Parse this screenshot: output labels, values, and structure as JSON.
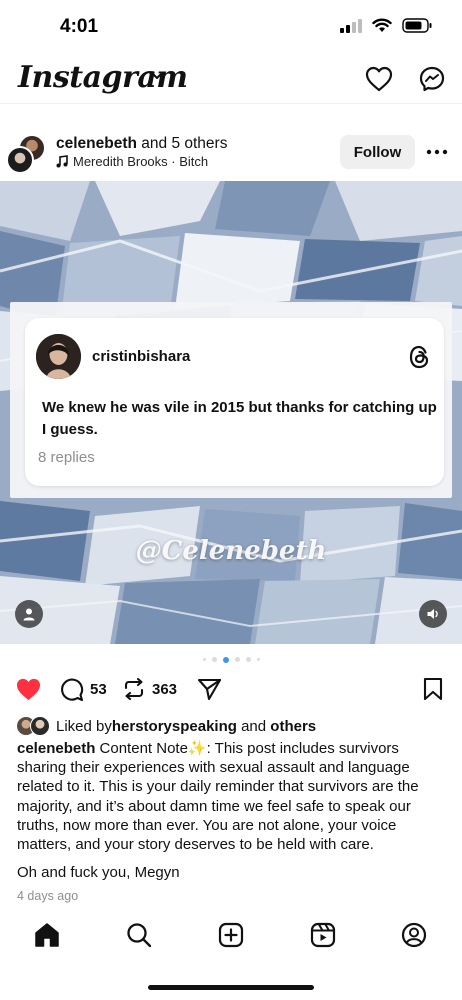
{
  "status_bar": {
    "time": "4:01"
  },
  "header": {
    "brand": "Instagram"
  },
  "post": {
    "author": "celenebeth",
    "author_suffix": " and 5 others",
    "music": "Meredith Brooks · Bitch",
    "follow_label": "Follow"
  },
  "card": {
    "username": "cristinbishara",
    "text": "We knew he was vile in 2015 but thanks for catching up I guess.",
    "replies": "8 replies"
  },
  "watermark": "@Celenebeth",
  "carousel": {
    "count": 6,
    "active_index": 2
  },
  "actions": {
    "comments": "53",
    "reposts": "363",
    "liked": true
  },
  "likes": {
    "prefix": "Liked by ",
    "user": "herstoryspeaking",
    "mid": " and ",
    "others": "others"
  },
  "caption": {
    "author": "celenebeth",
    "text": " Content Note✨: This post includes survivors sharing their experiences with sexual assault and language related to it. This is your daily reminder that survivors are the majority, and it’s about damn time we feel safe to speak our truths, now more than ever. You are not alone, your voice matters, and your story deserves to be held with care.",
    "text2": "Oh and fuck you, Megyn"
  },
  "time_ago": "4 days ago",
  "colors": {
    "like_red": "#ff3040",
    "dot_active": "#3897f0",
    "follow_bg": "#efefef",
    "muted": "#8e8e8e"
  },
  "icons": {
    "header": [
      "heart-icon",
      "messenger-icon"
    ],
    "tabs": [
      "home-icon",
      "search-icon",
      "create-icon",
      "reels-icon",
      "profile-icon"
    ]
  }
}
